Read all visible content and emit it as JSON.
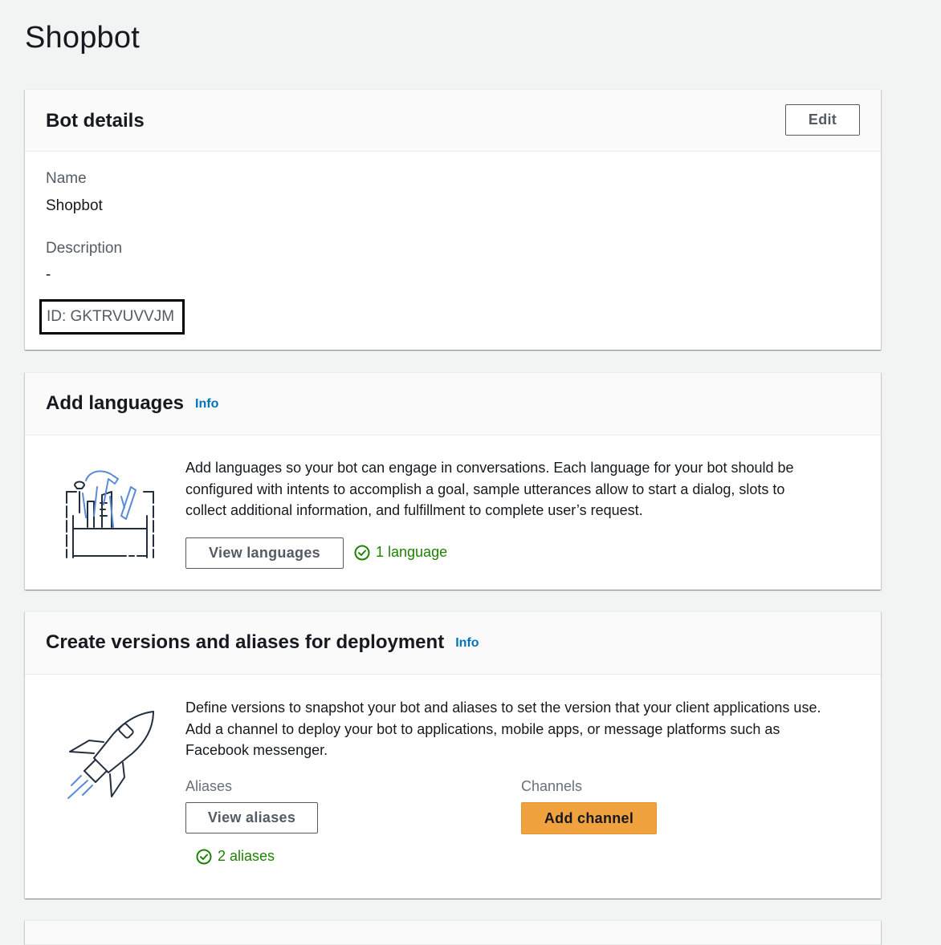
{
  "page": {
    "title": "Shopbot"
  },
  "bot_details": {
    "title": "Bot details",
    "edit_label": "Edit",
    "name_label": "Name",
    "name_value": "Shopbot",
    "description_label": "Description",
    "description_value": "-",
    "id_text": "ID: GKTRVUVVJM"
  },
  "languages": {
    "title": "Add languages",
    "info_label": "Info",
    "description_lines": [
      "Add languages so your bot can engage in conversations. Each language for your bot should be",
      "configured with intents to accomplish a goal, sample utterances allow to start a dialog, slots to",
      "collect additional information, and fulfillment to complete user’s request."
    ],
    "view_button_label": "View languages",
    "status_text": "1 language",
    "illustration_icon": "toolbox-icon"
  },
  "deployment": {
    "title": "Create versions and aliases for deployment",
    "info_label": "Info",
    "description_lines": [
      "Define versions to snapshot your bot and aliases to set the version that your client applications use.",
      "Add a channel to deploy your bot to applications, mobile apps, or message platforms such as",
      "Facebook messenger."
    ],
    "aliases_label": "Aliases",
    "view_aliases_label": "View aliases",
    "aliases_status_text": "2 aliases",
    "channels_label": "Channels",
    "add_channel_label": "Add channel",
    "illustration_icon": "rocket-icon"
  },
  "colors": {
    "page_background": "#f2f3f3",
    "card_header_background": "#fafafa",
    "link": "#0073bb",
    "success": "#1d8102",
    "primary_button": "#f0a23e",
    "text": "#16191f",
    "secondary_text": "#545b64"
  }
}
